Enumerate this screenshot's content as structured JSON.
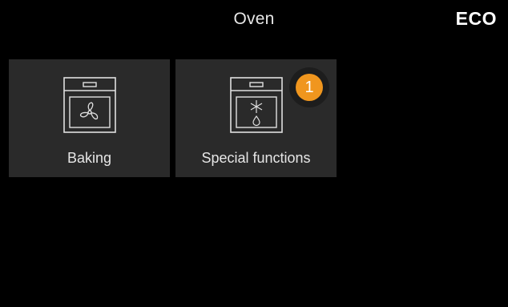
{
  "header": {
    "title": "Oven",
    "eco_label": "ECO"
  },
  "tiles": [
    {
      "label": "Baking",
      "icon": "oven-fan-icon"
    },
    {
      "label": "Special functions",
      "icon": "oven-special-function-icon"
    }
  ],
  "step_badge": {
    "number": "1",
    "color": "#f0961e"
  },
  "colors": {
    "background": "#000000",
    "tile_background": "#2a2a2a",
    "accent": "#f0961e"
  }
}
